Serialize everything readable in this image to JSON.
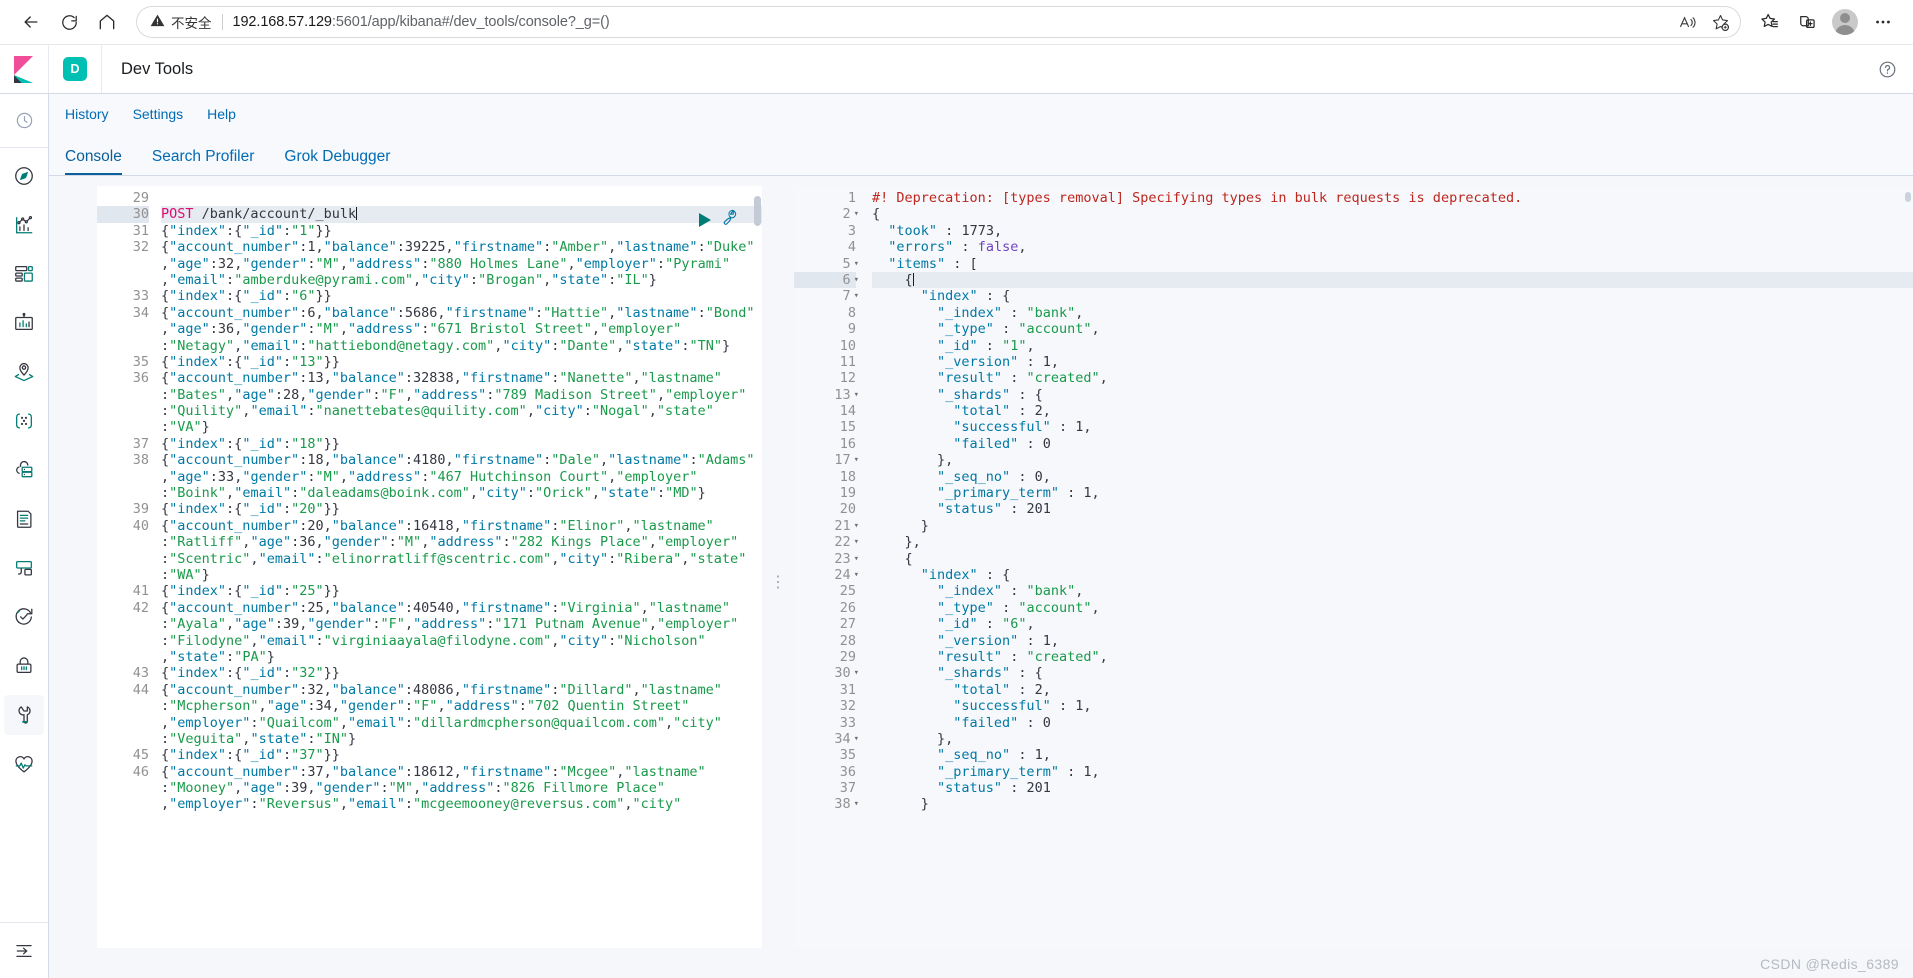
{
  "browser": {
    "back_label": "Back",
    "reload_label": "Refresh",
    "home_label": "Home",
    "security_warning": "不安全",
    "url_host": "192.168.57.129",
    "url_rest": ":5601/app/kibana#/dev_tools/console?_g=()",
    "read_aloud_label": "Read aloud",
    "add_favorite_label": "Add this page to favorites",
    "favorites_label": "Favorites",
    "collections_label": "Collections",
    "profile_label": "Profile",
    "settings_more_label": "Settings and more"
  },
  "kibana": {
    "space_initial": "D",
    "app_title": "Dev Tools",
    "help_icon": "question-in-circle-icon",
    "nav_items": [
      {
        "name": "recently-viewed",
        "icon": "clock-icon"
      },
      {
        "name": "discover",
        "icon": "compass-icon"
      },
      {
        "name": "visualize",
        "icon": "visualize-icon"
      },
      {
        "name": "dashboard",
        "icon": "dashboard-icon"
      },
      {
        "name": "canvas",
        "icon": "canvas-icon"
      },
      {
        "name": "maps",
        "icon": "maps-icon"
      },
      {
        "name": "machine-learning",
        "icon": "ml-icon"
      },
      {
        "name": "infrastructure",
        "icon": "infrastructure-icon"
      },
      {
        "name": "logs",
        "icon": "logs-icon"
      },
      {
        "name": "apm",
        "icon": "apm-icon"
      },
      {
        "name": "uptime",
        "icon": "uptime-icon"
      },
      {
        "name": "siem",
        "icon": "lock-icon"
      },
      {
        "name": "dev-tools",
        "icon": "wrench-icon"
      },
      {
        "name": "monitoring",
        "icon": "heart-pulse-icon"
      }
    ],
    "nav_collapse": "collapse-icon"
  },
  "devtools": {
    "topnav": [
      {
        "label": "History",
        "name": "history-link"
      },
      {
        "label": "Settings",
        "name": "settings-link"
      },
      {
        "label": "Help",
        "name": "help-link"
      }
    ],
    "tabs": [
      {
        "label": "Console",
        "name": "tab-console",
        "active": true
      },
      {
        "label": "Search Profiler",
        "name": "tab-search-profiler",
        "active": false
      },
      {
        "label": "Grok Debugger",
        "name": "tab-grok-debugger",
        "active": false
      }
    ],
    "actions": {
      "play_label": "Click to send request",
      "wrench_label": "Open documentation / auto indent"
    }
  },
  "request_editor": {
    "first_line_number": 29,
    "active_line": 30,
    "lines": [
      {
        "n": 29,
        "text": ""
      },
      {
        "n": 30,
        "text": "POST /bank/account/_bulk",
        "active": true
      },
      {
        "n": 31,
        "text": "{\"index\":{\"_id\":\"1\"}}"
      },
      {
        "n": 32,
        "text": "{\"account_number\":1,\"balance\":39225,\"firstname\":\"Amber\",\"lastname\":\"Duke\""
      },
      {
        "n": "",
        "text": ",\"age\":32,\"gender\":\"M\",\"address\":\"880 Holmes Lane\",\"employer\":\"Pyrami\""
      },
      {
        "n": "",
        "text": ",\"email\":\"amberduke@pyrami.com\",\"city\":\"Brogan\",\"state\":\"IL\"}"
      },
      {
        "n": 33,
        "text": "{\"index\":{\"_id\":\"6\"}}"
      },
      {
        "n": 34,
        "text": "{\"account_number\":6,\"balance\":5686,\"firstname\":\"Hattie\",\"lastname\":\"Bond\""
      },
      {
        "n": "",
        "text": ",\"age\":36,\"gender\":\"M\",\"address\":\"671 Bristol Street\",\"employer\""
      },
      {
        "n": "",
        "text": ":\"Netagy\",\"email\":\"hattiebond@netagy.com\",\"city\":\"Dante\",\"state\":\"TN\"}"
      },
      {
        "n": 35,
        "text": "{\"index\":{\"_id\":\"13\"}}"
      },
      {
        "n": 36,
        "text": "{\"account_number\":13,\"balance\":32838,\"firstname\":\"Nanette\",\"lastname\""
      },
      {
        "n": "",
        "text": ":\"Bates\",\"age\":28,\"gender\":\"F\",\"address\":\"789 Madison Street\",\"employer\""
      },
      {
        "n": "",
        "text": ":\"Quility\",\"email\":\"nanettebates@quility.com\",\"city\":\"Nogal\",\"state\""
      },
      {
        "n": "",
        "text": ":\"VA\"}"
      },
      {
        "n": 37,
        "text": "{\"index\":{\"_id\":\"18\"}}"
      },
      {
        "n": 38,
        "text": "{\"account_number\":18,\"balance\":4180,\"firstname\":\"Dale\",\"lastname\":\"Adams\""
      },
      {
        "n": "",
        "text": ",\"age\":33,\"gender\":\"M\",\"address\":\"467 Hutchinson Court\",\"employer\""
      },
      {
        "n": "",
        "text": ":\"Boink\",\"email\":\"daleadams@boink.com\",\"city\":\"Orick\",\"state\":\"MD\"}"
      },
      {
        "n": 39,
        "text": "{\"index\":{\"_id\":\"20\"}}"
      },
      {
        "n": 40,
        "text": "{\"account_number\":20,\"balance\":16418,\"firstname\":\"Elinor\",\"lastname\""
      },
      {
        "n": "",
        "text": ":\"Ratliff\",\"age\":36,\"gender\":\"M\",\"address\":\"282 Kings Place\",\"employer\""
      },
      {
        "n": "",
        "text": ":\"Scentric\",\"email\":\"elinorratliff@scentric.com\",\"city\":\"Ribera\",\"state\""
      },
      {
        "n": "",
        "text": ":\"WA\"}"
      },
      {
        "n": 41,
        "text": "{\"index\":{\"_id\":\"25\"}}"
      },
      {
        "n": 42,
        "text": "{\"account_number\":25,\"balance\":40540,\"firstname\":\"Virginia\",\"lastname\""
      },
      {
        "n": "",
        "text": ":\"Ayala\",\"age\":39,\"gender\":\"F\",\"address\":\"171 Putnam Avenue\",\"employer\""
      },
      {
        "n": "",
        "text": ":\"Filodyne\",\"email\":\"virginiaayala@filodyne.com\",\"city\":\"Nicholson\""
      },
      {
        "n": "",
        "text": ",\"state\":\"PA\"}"
      },
      {
        "n": 43,
        "text": "{\"index\":{\"_id\":\"32\"}}"
      },
      {
        "n": 44,
        "text": "{\"account_number\":32,\"balance\":48086,\"firstname\":\"Dillard\",\"lastname\""
      },
      {
        "n": "",
        "text": ":\"Mcpherson\",\"age\":34,\"gender\":\"F\",\"address\":\"702 Quentin Street\""
      },
      {
        "n": "",
        "text": ",\"employer\":\"Quailcom\",\"email\":\"dillardmcpherson@quailcom.com\",\"city\""
      },
      {
        "n": "",
        "text": ":\"Veguita\",\"state\":\"IN\"}"
      },
      {
        "n": 45,
        "text": "{\"index\":{\"_id\":\"37\"}}"
      },
      {
        "n": 46,
        "text": "{\"account_number\":37,\"balance\":18612,\"firstname\":\"Mcgee\",\"lastname\""
      },
      {
        "n": "",
        "text": ":\"Mooney\",\"age\":39,\"gender\":\"M\",\"address\":\"826 Fillmore Place\""
      },
      {
        "n": "",
        "text": ",\"employer\":\"Reversus\",\"email\":\"mcgeemooney@reversus.com\",\"city\""
      }
    ]
  },
  "response_editor": {
    "active_line": 6,
    "lines": [
      {
        "n": 1,
        "text": "#! Deprecation: [types removal] Specifying types in bulk requests is deprecated.",
        "kind": "warn"
      },
      {
        "n": 2,
        "text": "{",
        "fold": true
      },
      {
        "n": 3,
        "text": "  \"took\" : 1773,"
      },
      {
        "n": 4,
        "text": "  \"errors\" : false,"
      },
      {
        "n": 5,
        "text": "  \"items\" : [",
        "fold": true
      },
      {
        "n": 6,
        "text": "    {",
        "fold": true,
        "active": true
      },
      {
        "n": 7,
        "text": "      \"index\" : {",
        "fold": true
      },
      {
        "n": 8,
        "text": "        \"_index\" : \"bank\","
      },
      {
        "n": 9,
        "text": "        \"_type\" : \"account\","
      },
      {
        "n": 10,
        "text": "        \"_id\" : \"1\","
      },
      {
        "n": 11,
        "text": "        \"_version\" : 1,"
      },
      {
        "n": 12,
        "text": "        \"result\" : \"created\","
      },
      {
        "n": 13,
        "text": "        \"_shards\" : {",
        "fold": true
      },
      {
        "n": 14,
        "text": "          \"total\" : 2,"
      },
      {
        "n": 15,
        "text": "          \"successful\" : 1,"
      },
      {
        "n": 16,
        "text": "          \"failed\" : 0"
      },
      {
        "n": 17,
        "text": "        },",
        "fold": true
      },
      {
        "n": 18,
        "text": "        \"_seq_no\" : 0,"
      },
      {
        "n": 19,
        "text": "        \"_primary_term\" : 1,"
      },
      {
        "n": 20,
        "text": "        \"status\" : 201"
      },
      {
        "n": 21,
        "text": "      }",
        "fold": true
      },
      {
        "n": 22,
        "text": "    },",
        "fold": true
      },
      {
        "n": 23,
        "text": "    {",
        "fold": true
      },
      {
        "n": 24,
        "text": "      \"index\" : {",
        "fold": true
      },
      {
        "n": 25,
        "text": "        \"_index\" : \"bank\","
      },
      {
        "n": 26,
        "text": "        \"_type\" : \"account\","
      },
      {
        "n": 27,
        "text": "        \"_id\" : \"6\","
      },
      {
        "n": 28,
        "text": "        \"_version\" : 1,"
      },
      {
        "n": 29,
        "text": "        \"result\" : \"created\","
      },
      {
        "n": 30,
        "text": "        \"_shards\" : {",
        "fold": true
      },
      {
        "n": 31,
        "text": "          \"total\" : 2,"
      },
      {
        "n": 32,
        "text": "          \"successful\" : 1,"
      },
      {
        "n": 33,
        "text": "          \"failed\" : 0"
      },
      {
        "n": 34,
        "text": "        },",
        "fold": true
      },
      {
        "n": 35,
        "text": "        \"_seq_no\" : 1,"
      },
      {
        "n": 36,
        "text": "        \"_primary_term\" : 1,"
      },
      {
        "n": 37,
        "text": "        \"status\" : 201"
      },
      {
        "n": 38,
        "text": "      }",
        "fold": true
      }
    ]
  },
  "watermark": "CSDN @Redis_6389",
  "colors": {
    "accent": "#006bb4",
    "teal": "#00bfb3",
    "method": "#dd0a73",
    "key": "#0079a5",
    "string": "#1a9a4b",
    "warning": "#bd271e"
  }
}
